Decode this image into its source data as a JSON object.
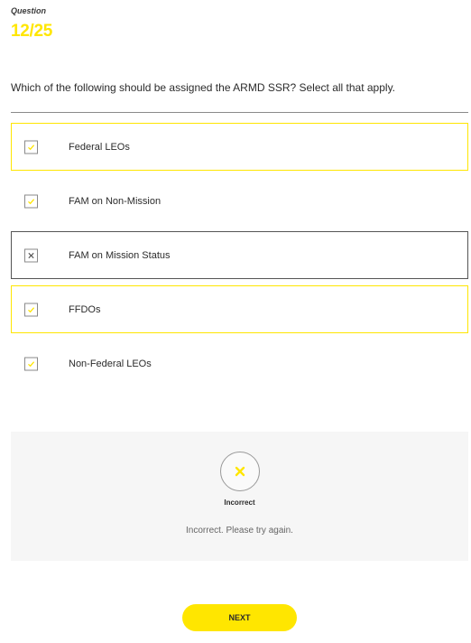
{
  "question": {
    "label": "Question",
    "counter": "12/25",
    "text": "Which of the following should be assigned the ARMD SSR? Select all that apply."
  },
  "options": [
    {
      "label": "Federal LEOs",
      "checked": true,
      "state": "correct",
      "mark": "check-icon"
    },
    {
      "label": "FAM on Non-Mission",
      "checked": true,
      "state": "none",
      "mark": "check-icon"
    },
    {
      "label": "FAM on Mission Status",
      "checked": false,
      "state": "wrong",
      "mark": "x-icon"
    },
    {
      "label": "FFDOs",
      "checked": true,
      "state": "correct",
      "mark": "check-icon"
    },
    {
      "label": "Non-Federal LEOs",
      "checked": true,
      "state": "none",
      "mark": "check-icon"
    }
  ],
  "feedback": {
    "icon": "x-icon",
    "title": "Incorrect",
    "message": "Incorrect. Please try again."
  },
  "next_button": {
    "label": "NEXT"
  },
  "colors": {
    "accent": "#ffe600",
    "text": "#2b2b2b",
    "feedback_bg": "#f6f6f6",
    "wrong_border": "#555555"
  }
}
